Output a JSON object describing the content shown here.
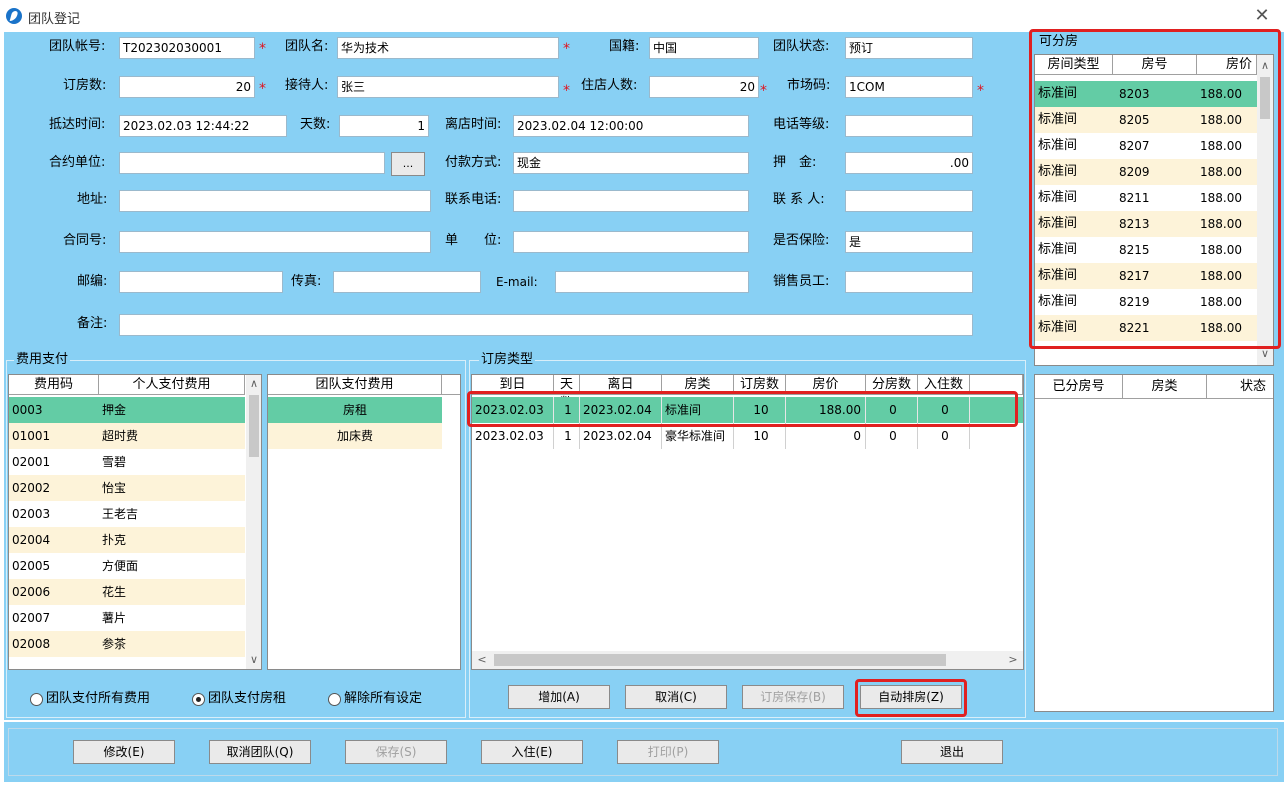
{
  "window": {
    "title": "团队登记"
  },
  "form": {
    "team_account_label": "团队帐号:",
    "team_account": "T202302030001",
    "team_name_label": "团队名:",
    "team_name": "华为技术",
    "nationality_label": "国籍:",
    "nationality": "中国",
    "team_status_label": "团队状态:",
    "team_status": "预订",
    "rooms_label": "订房数:",
    "rooms": "20",
    "receiver_label": "接待人:",
    "receiver": "张三",
    "guests_label": "住店人数:",
    "guests": "20",
    "market_label": "市场码:",
    "market": "1COM",
    "arrival_label": "抵达时间:",
    "arrival": "2023.02.03 12:44:22",
    "days_label": "天数:",
    "days": "1",
    "depart_label": "离店时间:",
    "depart": "2023.02.04 12:00:00",
    "phone_level_label": "电话等级:",
    "phone_level": "",
    "contract_unit_label": "合约单位:",
    "contract_unit": "",
    "browse_label": "...",
    "payment_label": "付款方式:",
    "payment": "现金",
    "deposit_label": "押　金:",
    "deposit": ".00",
    "address_label": "地址:",
    "address": "",
    "contact_phone_label": "联系电话:",
    "contact_phone": "",
    "contact_label": "联 系 人:",
    "contact": "",
    "contract_no_label": "合同号:",
    "contract_no": "",
    "unit_label": "单　　位:",
    "unit": "",
    "insurance_label": "是否保险:",
    "insurance": "是",
    "postcode_label": "邮编:",
    "postcode": "",
    "fax_label": "传真:",
    "fax": "",
    "email_label": "E-mail:",
    "email": "",
    "sales_label": "销售员工:",
    "sales": "",
    "remark_label": "备注:",
    "remark": ""
  },
  "fee": {
    "title": "费用支付",
    "col_code": "费用码",
    "col_personal": "个人支付费用",
    "rows": [
      {
        "code": "0003",
        "name": "押金"
      },
      {
        "code": "01001",
        "name": "超时费"
      },
      {
        "code": "02001",
        "name": "雪碧"
      },
      {
        "code": "02002",
        "name": "怡宝"
      },
      {
        "code": "02003",
        "name": "王老吉"
      },
      {
        "code": "02004",
        "name": "扑克"
      },
      {
        "code": "02005",
        "name": "方便面"
      },
      {
        "code": "02006",
        "name": "花生"
      },
      {
        "code": "02007",
        "name": "薯片"
      },
      {
        "code": "02008",
        "name": "参茶"
      }
    ],
    "team_col": "团队支付费用",
    "team_rows": [
      "房租",
      "加床费"
    ],
    "radio": [
      "团队支付所有费用",
      "团队支付房租",
      "解除所有设定"
    ],
    "radio_selected": 1
  },
  "booking": {
    "title": "订房类型",
    "cols": [
      "到日",
      "天数",
      "离日",
      "房类",
      "订房数",
      "房价",
      "分房数",
      "入住数"
    ],
    "rows": [
      [
        "2023.02.03",
        "1",
        "2023.02.04",
        "标准间",
        "10",
        "188.00",
        "0",
        "0"
      ],
      [
        "2023.02.03",
        "1",
        "2023.02.04",
        "豪华标准间",
        "10",
        "0",
        "0",
        "0"
      ]
    ],
    "buttons": {
      "add": "增加(A)",
      "cancel": "取消(C)",
      "save": "订房保存(B)",
      "auto": "自动排房(Z)"
    }
  },
  "available": {
    "title": "可分房",
    "cols": [
      "房间类型",
      "房号",
      "房价"
    ],
    "rows": [
      [
        "标准间",
        "8203",
        "188.00"
      ],
      [
        "标准间",
        "8205",
        "188.00"
      ],
      [
        "标准间",
        "8207",
        "188.00"
      ],
      [
        "标准间",
        "8209",
        "188.00"
      ],
      [
        "标准间",
        "8211",
        "188.00"
      ],
      [
        "标准间",
        "8213",
        "188.00"
      ],
      [
        "标准间",
        "8215",
        "188.00"
      ],
      [
        "标准间",
        "8217",
        "188.00"
      ],
      [
        "标准间",
        "8219",
        "188.00"
      ],
      [
        "标准间",
        "8221",
        "188.00"
      ]
    ]
  },
  "assigned": {
    "cols": [
      "已分房号",
      "房类",
      "状态"
    ]
  },
  "bottom": {
    "modify": "修改(E)",
    "cancel_team": "取消团队(Q)",
    "save": "保存(S)",
    "checkin": "入住(E)",
    "print": "打印(P)",
    "exit": "退出"
  },
  "colors": {
    "background": "#88d0f4",
    "selected": "#63cca5",
    "alt_row": "#fdf3d9",
    "highlight": "#e02020"
  }
}
